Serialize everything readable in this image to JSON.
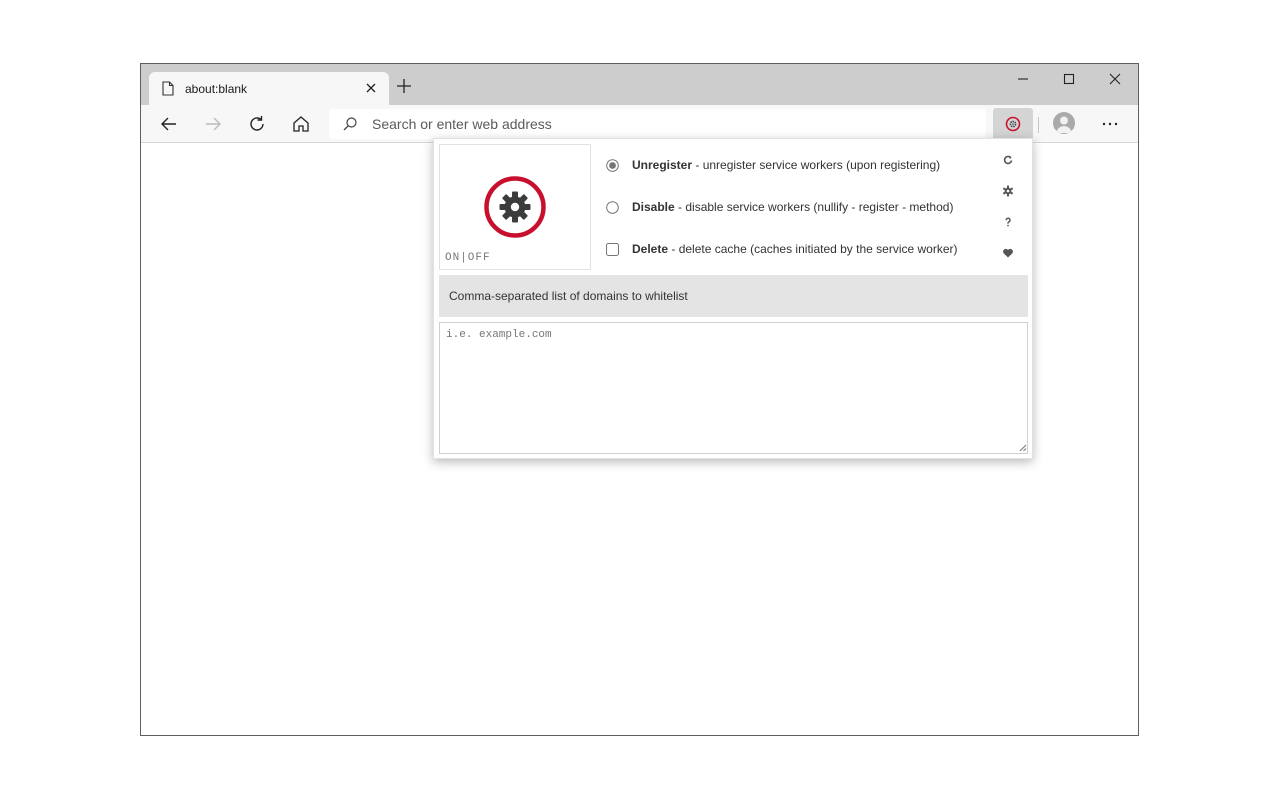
{
  "tab": {
    "title": "about:blank"
  },
  "address_bar": {
    "placeholder": "Search or enter web address"
  },
  "popup": {
    "toggle_label": "ON|OFF",
    "options": [
      {
        "name": "Unregister",
        "desc": " - unregister service workers (upon registering)",
        "type": "radio",
        "checked": true
      },
      {
        "name": "Disable",
        "desc": " - disable service workers (nullify - register - method)",
        "type": "radio",
        "checked": false
      },
      {
        "name": "Delete",
        "desc": " - delete cache (caches initiated by the service worker)",
        "type": "checkbox",
        "checked": false
      }
    ],
    "side_icons": [
      "refresh-icon",
      "gear-icon",
      "question-icon",
      "heart-icon"
    ],
    "whitelist_label": "Comma-separated list of domains to whitelist",
    "whitelist_placeholder": "i.e. example.com",
    "whitelist_value": ""
  },
  "colors": {
    "accent": "#c8102e",
    "gear": "#3c3c3c",
    "tabbar": "#cdcdcd",
    "toolbar": "#f7f7f7"
  }
}
